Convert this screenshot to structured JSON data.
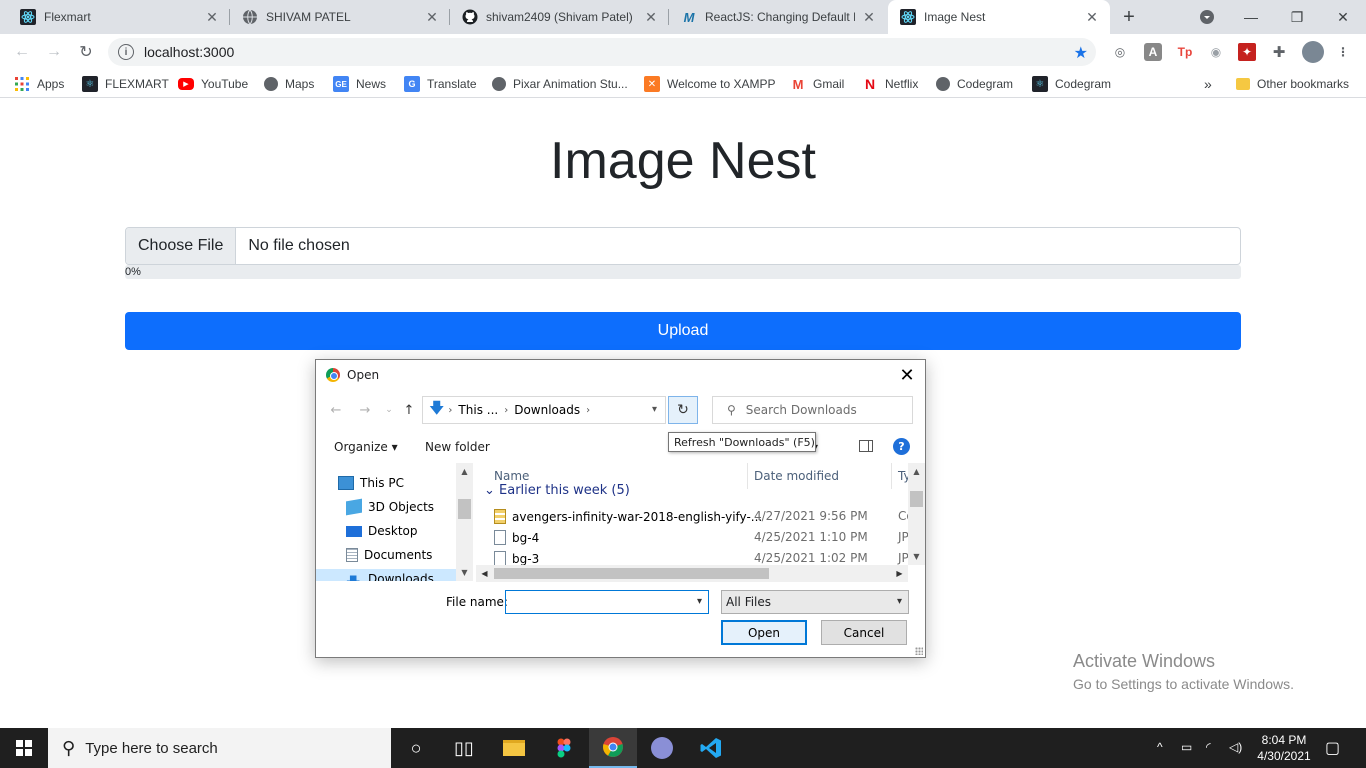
{
  "tabs": [
    {
      "title": "Flexmart",
      "icon": "react-icon"
    },
    {
      "title": "SHIVAM PATEL",
      "icon": "globe-icon"
    },
    {
      "title": "shivam2409 (Shivam Patel)",
      "icon": "github-icon"
    },
    {
      "title": "ReactJS: Changing Default Po",
      "icon": "medium-icon"
    },
    {
      "title": "Image Nest",
      "icon": "react-icon",
      "active": true
    }
  ],
  "omnibox": {
    "url": "localhost:3000"
  },
  "bookmarks": {
    "items": [
      "Apps",
      "FLEXMART",
      "YouTube",
      "Maps",
      "News",
      "Translate",
      "Pixar Animation Stu...",
      "Welcome to XAMPP",
      "Gmail",
      "Netflix",
      "Codegram",
      "Codegram"
    ],
    "overflow": "»",
    "other": "Other bookmarks"
  },
  "page": {
    "title": "Image Nest",
    "choose_file": "Choose File",
    "no_file": "No file chosen",
    "progress_label": "0%",
    "progress_value": 0,
    "upload": "Upload",
    "accent": "#0d6efd"
  },
  "activate": {
    "line1": "Activate Windows",
    "line2": "Go to Settings to activate Windows."
  },
  "dialog": {
    "title": "Open",
    "path": [
      "This ...",
      "Downloads"
    ],
    "search_placeholder": "Search Downloads",
    "tooltip": "Refresh \"Downloads\" (F5)",
    "organize": "Organize",
    "new_folder": "New folder",
    "nav": [
      "This PC",
      "3D Objects",
      "Desktop",
      "Documents",
      "Downloads"
    ],
    "columns": {
      "name": "Name",
      "date": "Date modified",
      "type": "Ty"
    },
    "group": "Earlier this week (5)",
    "files": [
      {
        "name": "avengers-infinity-war-2018-english-yify-...",
        "date": "4/27/2021 9:56 PM",
        "type": "Co"
      },
      {
        "name": "bg-4",
        "date": "4/25/2021 1:10 PM",
        "type": "JP"
      },
      {
        "name": "bg-3",
        "date": "4/25/2021 1:02 PM",
        "type": "JP"
      }
    ],
    "file_name_label": "File name:",
    "file_name_value": "",
    "filter": "All Files",
    "open": "Open",
    "cancel": "Cancel"
  },
  "taskbar": {
    "search": "Type here to search",
    "time": "8:04 PM",
    "date": "4/30/2021"
  }
}
